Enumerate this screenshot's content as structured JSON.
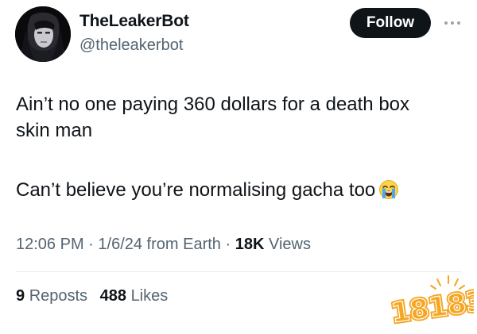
{
  "tweet": {
    "display_name": "TheLeakerBot",
    "handle": "@theleakerbot",
    "follow_label": "Follow",
    "text_lines": [
      "Ain’t no one paying 360 dollars for a death box",
      "skin man",
      "Can’t believe you’re normalising gacha too"
    ],
    "emoji": "loudly-crying-face",
    "meta": {
      "time": "12:06 PM",
      "sep1": " · ",
      "date": "1/6/24",
      "location": " from Earth",
      "sep2": " · ",
      "views_count": "18K",
      "views_label": " Views"
    },
    "stats": {
      "reposts_count": "9",
      "reposts_label": "Reposts",
      "likes_count": "488",
      "likes_label": "Likes"
    }
  },
  "watermark": {
    "text": "18183",
    "color": "#f5a623"
  },
  "colors": {
    "text_primary": "#0f1419",
    "text_secondary": "#536471",
    "button_bg": "#0f1419",
    "divider": "#e6ecf0"
  }
}
